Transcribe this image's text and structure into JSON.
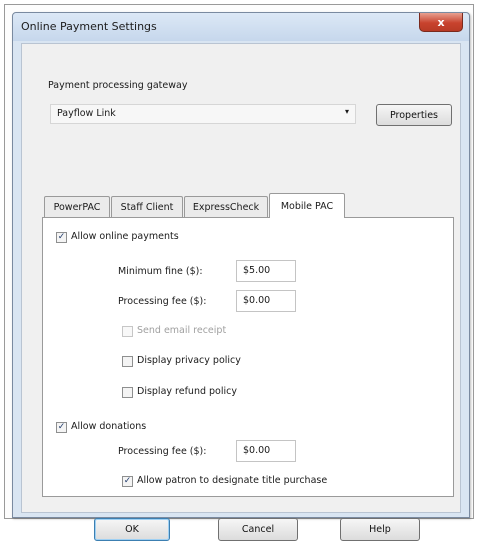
{
  "window": {
    "title": "Online Payment Settings",
    "close_glyph": "x"
  },
  "gateway": {
    "label": "Payment processing gateway",
    "selected": "Payflow Link",
    "dropdown_arrow": "▾",
    "properties_label": "Properties"
  },
  "tabs": [
    {
      "label": "PowerPAC",
      "active": false
    },
    {
      "label": "Staff Client",
      "active": false
    },
    {
      "label": "ExpressCheck",
      "active": false
    },
    {
      "label": "Mobile PAC",
      "active": true
    }
  ],
  "payments": {
    "allow_label": "Allow online payments",
    "allow_checked": true,
    "min_fine_label": "Minimum fine ($):",
    "min_fine_value": "$5.00",
    "processing_fee_label": "Processing fee ($):",
    "processing_fee_value": "$0.00",
    "send_email_label": "Send email receipt",
    "send_email_checked": false,
    "send_email_enabled": false,
    "privacy_label": "Display privacy policy",
    "privacy_checked": false,
    "refund_label": "Display refund policy",
    "refund_checked": false
  },
  "donations": {
    "allow_label": "Allow donations",
    "allow_checked": true,
    "processing_fee_label": "Processing fee ($):",
    "processing_fee_value": "$0.00",
    "designate_label": "Allow patron to designate title purchase",
    "designate_checked": true
  },
  "footer": {
    "ok_label": "OK",
    "cancel_label": "Cancel",
    "help_label": "Help"
  },
  "check_glyph": "✓",
  "colors": {
    "titlebar": "#c6d7ec",
    "close_button": "#c8432e",
    "focus_border": "#3c7fb1"
  }
}
